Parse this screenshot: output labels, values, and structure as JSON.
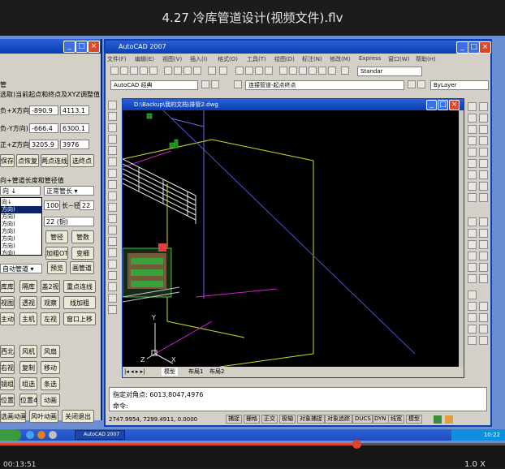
{
  "player": {
    "title": "4.27 冷库管道设计(视频文件).flv",
    "time": "00:13:51",
    "speed": "1.0 X",
    "progress": 0.706
  },
  "plugin": {
    "title_buttons": [
      "_",
      "□",
      "×"
    ],
    "heading": "管",
    "coord_label": "选取)当前起点和终点及XYZ调整值",
    "rows": [
      {
        "label": "负+X方向)",
        "value1": "-890.9",
        "value2": "4113.1"
      },
      {
        "label": "负-Y方向)",
        "value1": "-666.4",
        "value2": "6300.1"
      },
      {
        "label": "正+Z方向)",
        "value1": "3205.9",
        "value2": "3976"
      }
    ],
    "btns1": [
      "保存",
      "点恢复",
      "两点连线",
      "选终点"
    ],
    "section2": "向+管道长度和管径值",
    "combo_a": "向 ↓",
    "combo_b": "正常管长 ▾",
    "dropdown_items": [
      "向↓",
      "方向)",
      "方向)",
      "方向)",
      "方向)",
      "方向)",
      "方向)",
      "方向)"
    ],
    "length_value": "1000",
    "length_label": "长~径",
    "length_value2": "22",
    "pipe_combo": "22 (铜)",
    "btn_pipe": "管径",
    "btn_count": "管数",
    "btn_addlong": "加粗OT",
    "btn_change": "变细",
    "auto_combo": "自动管道 ▾",
    "btn_preview": "预览",
    "btn_draw": "画管道",
    "grid": [
      [
        "库库",
        "隔库",
        "盖2视",
        "重点连线"
      ],
      [
        "视图",
        "透视",
        "观察",
        "线加粗"
      ],
      [
        "主动",
        "主机",
        "左视",
        "窗口上移"
      ],
      [
        "西北",
        "风机",
        "风扇",
        ""
      ],
      [
        "右视",
        "复制",
        "移动",
        ""
      ],
      [
        "镜组",
        "组选",
        "条选",
        ""
      ],
      [
        "位置3",
        "位置4",
        "动画",
        ""
      ],
      [
        "选画动画",
        "风叶动画",
        "关闭退出",
        ""
      ]
    ]
  },
  "autocad": {
    "title": "AutoCAD 2007",
    "title_buttons": [
      "_",
      "□",
      "×"
    ],
    "menu": [
      "文件(F)",
      "编辑(E)",
      "视图(V)",
      "插入(I)",
      "格式(O)",
      "工具(T)",
      "绘图(D)",
      "标注(N)",
      "修改(M)",
      "Express",
      "窗口(W)",
      "帮助(H)"
    ],
    "style_combo": "AutoCAD 经典",
    "layer_combo": "连接管道-起点终点",
    "bylayer": "ByLayer",
    "standard": "Standar",
    "drawing_title": "D:\\Backup\\我的文档\\排管2.dwg",
    "tabs": [
      "模型",
      "布局1",
      "布局2"
    ],
    "cmd_line1": "指定对角点: 6013,8047,4976",
    "cmd_line2": "命令:",
    "status_coords": "2747.9954, 7299.4911, 0.0000",
    "status_buttons": [
      "捕捉",
      "栅格",
      "正交",
      "极轴",
      "对象捕捉",
      "对象追踪",
      "DUCS",
      "DYN",
      "线宽",
      "模型"
    ]
  },
  "taskbar": {
    "task_label": "AutoCAD 2007",
    "clock": "10:22"
  },
  "colors": {
    "accent": "#e0422e",
    "xp_blue": "#0a3fb0",
    "canvas_bg": "#000000"
  }
}
